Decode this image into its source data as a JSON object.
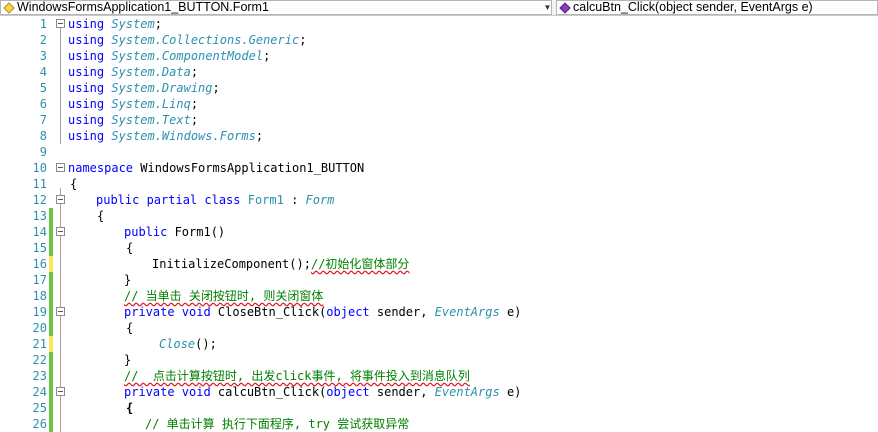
{
  "navbar": {
    "class_selector": "WindowsFormsApplication1_BUTTON.Form1",
    "member_selector": "calcuBtn_Click(object sender, EventArgs e)"
  },
  "lines": {
    "l1": {
      "num": "1",
      "kw": "using",
      "ns": "System",
      "end": ";"
    },
    "l2": {
      "num": "2",
      "kw": "using",
      "ns": "System.Collections.Generic",
      "end": ";"
    },
    "l3": {
      "num": "3",
      "kw": "using",
      "ns": "System.ComponentModel",
      "end": ";"
    },
    "l4": {
      "num": "4",
      "kw": "using",
      "ns": "System.Data",
      "end": ";"
    },
    "l5": {
      "num": "5",
      "kw": "using",
      "ns": "System.Drawing",
      "end": ";"
    },
    "l6": {
      "num": "6",
      "kw": "using",
      "ns": "System.Linq",
      "end": ";"
    },
    "l7": {
      "num": "7",
      "kw": "using",
      "ns": "System.Text",
      "end": ";"
    },
    "l8": {
      "num": "8",
      "kw": "using",
      "ns": "System.Windows.Forms",
      "end": ";"
    },
    "l9": {
      "num": "9"
    },
    "l10": {
      "num": "10",
      "kw": "namespace",
      "name": " WindowsFormsApplication1_BUTTON"
    },
    "l11": {
      "num": "11",
      "text": "{"
    },
    "l12": {
      "num": "12",
      "kw": "public partial class",
      "name": "Form1",
      "sep": " : ",
      "base": "Form"
    },
    "l13": {
      "num": "13",
      "text": "{"
    },
    "l14": {
      "num": "14",
      "kw": "public",
      "name": " Form1()"
    },
    "l15": {
      "num": "15",
      "text": "{"
    },
    "l16": {
      "num": "16",
      "call": "InitializeComponent",
      "rest": "();",
      "comment": "//初始化窗体部分"
    },
    "l17": {
      "num": "17",
      "text": "}"
    },
    "l18": {
      "num": "18",
      "comment": "// 当单击 关闭按钮时, 则关闭窗体"
    },
    "l19": {
      "num": "19",
      "kw": "private void",
      "name": " CloseBtn_Click(",
      "kw2": "object",
      "mid": " sender, ",
      "type": "EventArgs",
      "tail": " e)"
    },
    "l20": {
      "num": "20",
      "text": "{"
    },
    "l21": {
      "num": "21",
      "call": "Close",
      "rest": "();"
    },
    "l22": {
      "num": "22",
      "text": "}"
    },
    "l23": {
      "num": "23",
      "comment": "//  点击计算按钮时, 出发click事件, 将事件投入到消息队列"
    },
    "l24": {
      "num": "24",
      "kw": "private void",
      "name": " calcuBtn_Click(",
      "kw2": "object",
      "mid": " sender, ",
      "type": "EventArgs",
      "tail": " e)"
    },
    "l25": {
      "num": "25",
      "text": "{"
    },
    "l26": {
      "num": "26",
      "comment": "// 单击计算 执行下面程序, try 尝试获取异常"
    }
  },
  "colors": {
    "keyword": "#0000ff",
    "type": "#2b91af",
    "comment": "#008000",
    "line_number": "#2b91af"
  },
  "icons": {
    "class_selector": "class-icon",
    "member_selector": "method-icon",
    "dropdown": "chevron-down-icon",
    "outline": "collapse-box-icon"
  }
}
